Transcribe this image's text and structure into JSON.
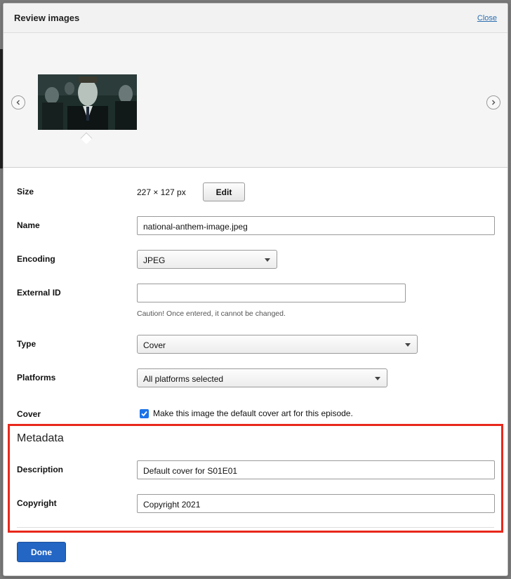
{
  "dialog": {
    "title": "Review images",
    "close_label": "Close"
  },
  "carousel": {
    "prev_icon": "chevron-left-icon",
    "next_icon": "chevron-right-icon",
    "thumbnail_alt": "national-anthem-image thumbnail"
  },
  "form": {
    "size": {
      "label": "Size",
      "value": "227 × 127 px",
      "edit_label": "Edit"
    },
    "name": {
      "label": "Name",
      "value": "national-anthem-image.jpeg"
    },
    "encoding": {
      "label": "Encoding",
      "value": "JPEG"
    },
    "external_id": {
      "label": "External ID",
      "value": "",
      "caution": "Caution! Once entered, it cannot be changed."
    },
    "type": {
      "label": "Type",
      "value": "Cover"
    },
    "platforms": {
      "label": "Platforms",
      "value": "All platforms selected"
    },
    "cover": {
      "label": "Cover",
      "checked": true,
      "text": "Make this image the default cover art for this episode."
    }
  },
  "metadata": {
    "title": "Metadata",
    "description": {
      "label": "Description",
      "value": "Default cover for S01E01"
    },
    "copyright": {
      "label": "Copyright",
      "value": "Copyright 2021"
    }
  },
  "footer": {
    "done_label": "Done"
  },
  "colors": {
    "accent": "#2366c4",
    "highlight_border": "#e8281b",
    "checkbox": "#1a73e8"
  }
}
